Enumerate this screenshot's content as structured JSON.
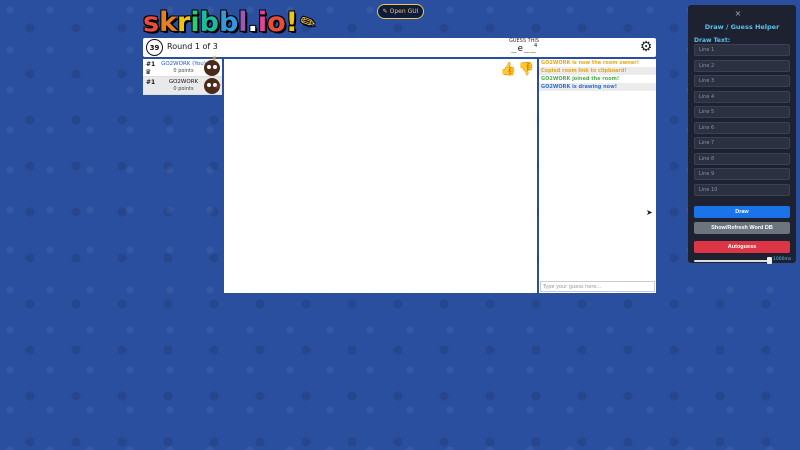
{
  "logo": {
    "letters": [
      "s",
      "k",
      "r",
      "i",
      "b",
      "b",
      "l",
      ".",
      "i",
      "o",
      "!"
    ],
    "colors": [
      "#e74c3c",
      "#e67e22",
      "#f1c40f",
      "#2ecc71",
      "#1abc9c",
      "#3498db",
      "#9b59b6",
      "#ffffff",
      "#e84393",
      "#e74c3c",
      "#f1c40f"
    ]
  },
  "open_gui": {
    "icon": "pencil-icon",
    "label": "Open GUI"
  },
  "topbar": {
    "timer": "39",
    "round": "Round 1 of 3",
    "guess_label": "GUESS THIS",
    "word_hint": "_e__",
    "word_count": "4",
    "settings_icon": "gear-icon"
  },
  "players": [
    {
      "rank": "#1",
      "name": "GO2WORK (You)",
      "points": "0 points",
      "is_owner": true,
      "is_drawing": false
    },
    {
      "rank": "#1",
      "name": "GO2WORK",
      "points": "0 points",
      "is_owner": false,
      "is_drawing": true
    }
  ],
  "chat": {
    "messages": [
      {
        "text": "GO2WORK is now the room owner!",
        "color": "yellow"
      },
      {
        "text": "Copied room link to clipboard!",
        "color": "yellow"
      },
      {
        "text": "GO2WORK joined the room!",
        "color": "green"
      },
      {
        "text": "GO2WORK is drawing now!",
        "color": "blue"
      }
    ],
    "input_placeholder": "Type your guess here..."
  },
  "helper": {
    "close": "×",
    "title": "Draw / Guess Helper",
    "draw_label": "Draw Text:",
    "lines": [
      "Line 1",
      "Line 2",
      "Line 3",
      "Line 4",
      "Line 5",
      "Line 6",
      "Line 7",
      "Line 8",
      "Line 9",
      "Line 10"
    ],
    "draw_button": "Draw",
    "refresh_button": "Show/Refresh Word DB",
    "autoguess_button": "Autoguess",
    "slider_value": "1000ms"
  }
}
